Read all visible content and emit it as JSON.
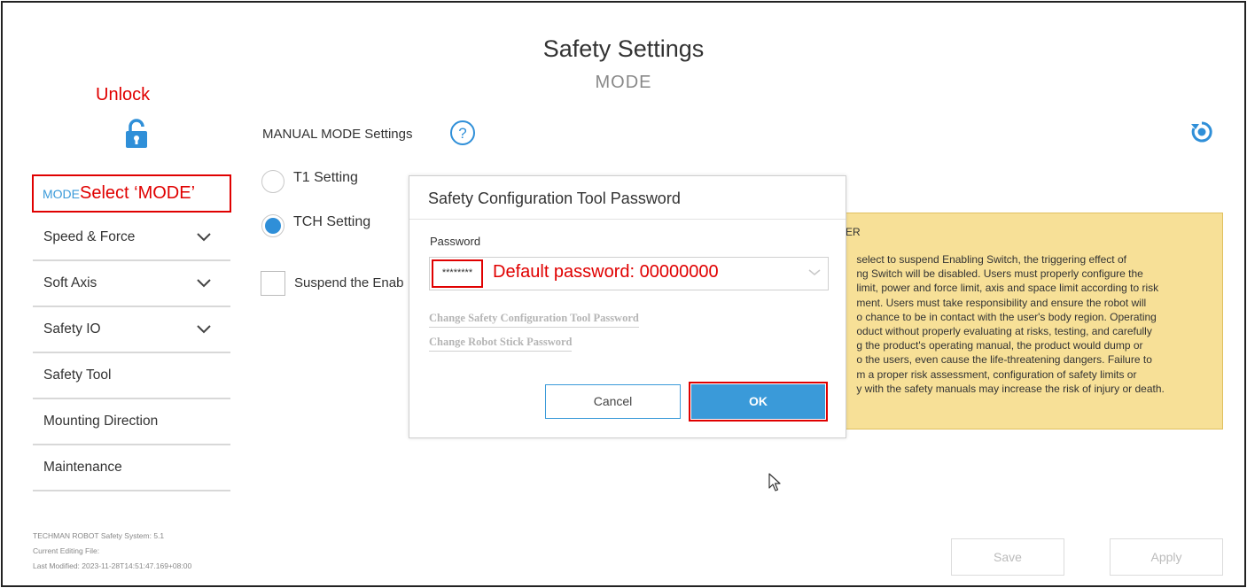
{
  "header": {
    "title": "Safety Settings",
    "subtitle": "MODE"
  },
  "annotations": {
    "unlock": "Unlock",
    "select_mode": "Select ‘MODE’",
    "default_password": "Default password: 00000000"
  },
  "icons": {
    "lock": "unlocked-padlock-icon",
    "help": "question-mark-circle-icon",
    "refresh": "refresh-icon",
    "chevron": "chevron-down-icon",
    "cursor": "mouse-pointer-icon"
  },
  "sidebar": {
    "active_item": "MODE",
    "items": [
      {
        "label": "Speed & Force",
        "expandable": true
      },
      {
        "label": "Soft Axis",
        "expandable": true
      },
      {
        "label": "Safety IO",
        "expandable": true
      },
      {
        "label": "Safety Tool",
        "expandable": false
      },
      {
        "label": "Mounting Direction",
        "expandable": false
      },
      {
        "label": "Maintenance",
        "expandable": false
      }
    ],
    "system_info": {
      "version": "TECHMAN ROBOT Safety System:  5.1",
      "editing_file": "Current Editing File:",
      "last_modified": "Last Modified:  2023-11-28T14:51:47.169+08:00"
    }
  },
  "main": {
    "manual_mode_label": "MANUAL MODE Settings",
    "radio_t1": "T1 Setting",
    "radio_tch": "TCH Setting",
    "selected_radio": "TCH Setting",
    "suspend_label": "Suspend the Enab",
    "warning_title": "ER",
    "warning_text": "       select to suspend Enabling Switch, the triggering effect of\n       ng Switch will be disabled. Users must properly configure the\n       limit, power and force limit, axis and space limit according to risk\n       ment. Users must take responsibility and ensure the robot will\n       o chance to be in contact with the user's body region. Operating\n       oduct without properly evaluating at risks, testing, and carefully\n       g the product's operating manual, the product would dump or\n       o the users, even cause the life-threatening dangers. Failure to\n       m a proper risk assessment, configuration of safety limits or\n       y with the safety manuals may increase the risk of injury or death."
  },
  "dialog": {
    "title": "Safety Configuration Tool Password",
    "password_label": "Password",
    "password_value": "********",
    "link_change_tool_password": "Change Safety Configuration Tool Password",
    "link_change_stick_password": "Change Robot Stick Password",
    "cancel": "Cancel",
    "ok": "OK"
  },
  "footer": {
    "save": "Save",
    "apply": "Apply"
  },
  "colors": {
    "accent": "#3a9ad9",
    "annotation_red": "#e00000",
    "warning_bg": "#f7e097"
  }
}
